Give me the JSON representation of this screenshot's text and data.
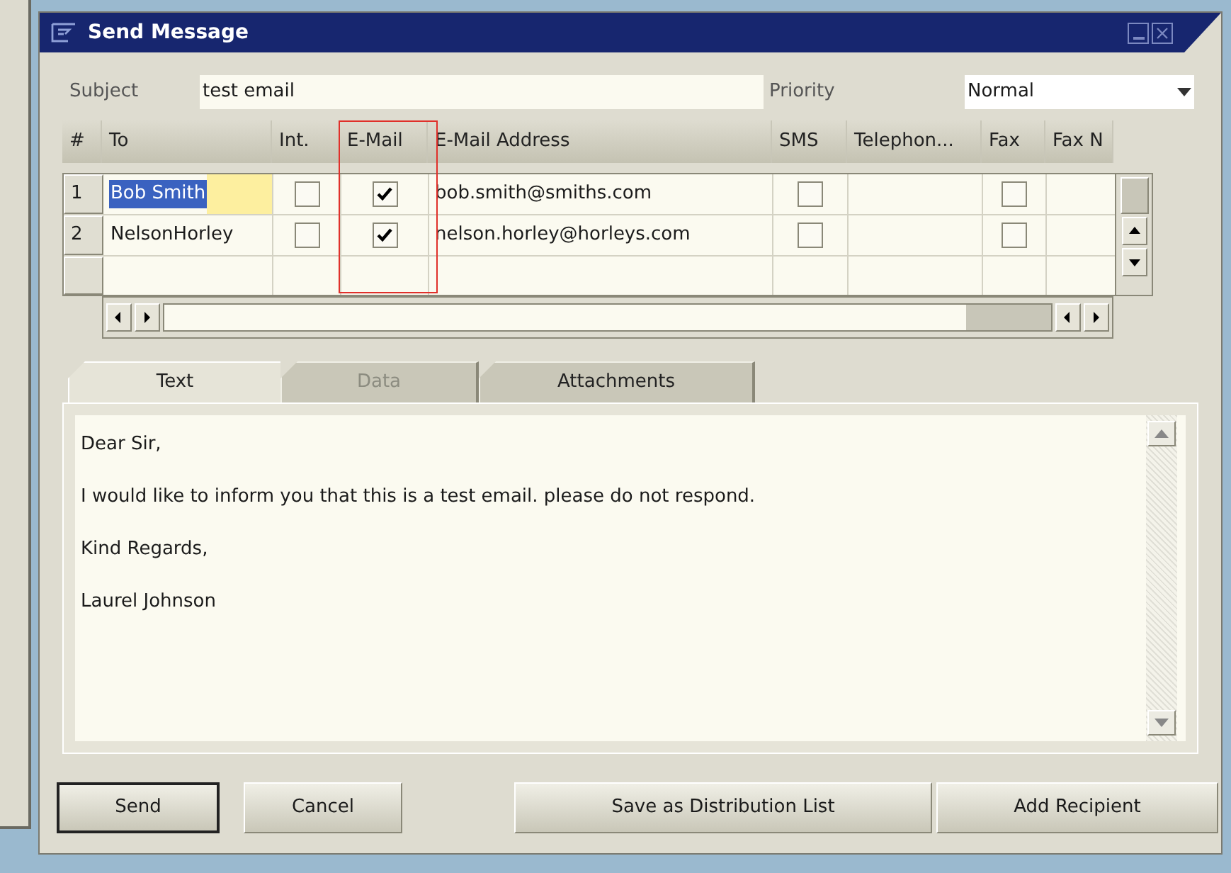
{
  "window": {
    "title": "Send Message"
  },
  "subject": {
    "label": "Subject",
    "value": "test email"
  },
  "priority": {
    "label": "Priority",
    "value": "Normal"
  },
  "table": {
    "columns": [
      {
        "label": "#",
        "highlighted": false
      },
      {
        "label": "To",
        "highlighted": false
      },
      {
        "label": "Int.",
        "highlighted": false
      },
      {
        "label": "E-Mail",
        "highlighted": true
      },
      {
        "label": "E-Mail Address",
        "highlighted": false
      },
      {
        "label": "SMS",
        "highlighted": false
      },
      {
        "label": "Telephon...",
        "highlighted": false
      },
      {
        "label": "Fax",
        "highlighted": false
      },
      {
        "label": "Fax N",
        "highlighted": false
      }
    ],
    "rows": [
      {
        "number": "1",
        "to": "Bob Smith",
        "selected": true,
        "internal": false,
        "email": true,
        "address": "bob.smith@smiths.com",
        "sms": false,
        "fax": false
      },
      {
        "number": "2",
        "to": "NelsonHorley",
        "selected": false,
        "internal": false,
        "email": true,
        "address": "nelson.horley@horleys.com",
        "sms": false,
        "fax": false
      }
    ]
  },
  "tabs": [
    {
      "label": "Text",
      "selected": true,
      "disabled": false
    },
    {
      "label": "Data",
      "selected": false,
      "disabled": true
    },
    {
      "label": "Attachments",
      "selected": false,
      "disabled": false
    }
  ],
  "message": [
    "Dear Sir,",
    "I would like to inform you that this is a test email. please do not respond.",
    "Kind Regards,",
    "Laurel Johnson"
  ],
  "buttons": [
    {
      "label": "Send",
      "default": true
    },
    {
      "label": "Cancel",
      "default": false
    },
    {
      "label": "Save as Distribution List",
      "default": false
    },
    {
      "label": "Add Recipient",
      "default": false
    }
  ]
}
